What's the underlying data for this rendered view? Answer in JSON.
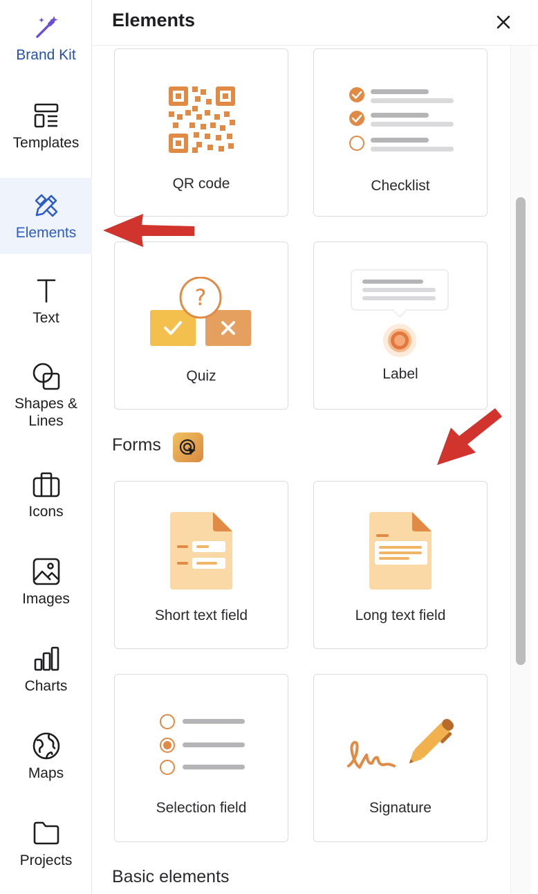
{
  "sidebar": {
    "items": [
      {
        "label": "Brand Kit",
        "icon": "magic-wand-icon"
      },
      {
        "label": "Templates",
        "icon": "templates-icon"
      },
      {
        "label": "Elements",
        "icon": "elements-icon",
        "active": true
      },
      {
        "label": "Text",
        "icon": "text-icon"
      },
      {
        "label": "Shapes &\nLines",
        "icon": "shapes-icon"
      },
      {
        "label": "Icons",
        "icon": "briefcase-icon"
      },
      {
        "label": "Images",
        "icon": "image-icon"
      },
      {
        "label": "Charts",
        "icon": "bar-chart-icon"
      },
      {
        "label": "Maps",
        "icon": "globe-icon"
      },
      {
        "label": "Projects",
        "icon": "folder-icon"
      }
    ]
  },
  "panel": {
    "title": "Elements",
    "close_icon": "close-icon"
  },
  "cards": {
    "qr_code": "QR code",
    "checklist": "Checklist",
    "quiz": "Quiz",
    "label": "Label",
    "short_text_field": "Short text field",
    "long_text_field": "Long text field",
    "selection_field": "Selection field",
    "signature": "Signature"
  },
  "sections": {
    "forms": "Forms",
    "basic_elements": "Basic elements"
  },
  "colors": {
    "accent_orange": "#e08a45",
    "active_blue": "#2c5cc5",
    "arrow_red": "#d0342c"
  }
}
